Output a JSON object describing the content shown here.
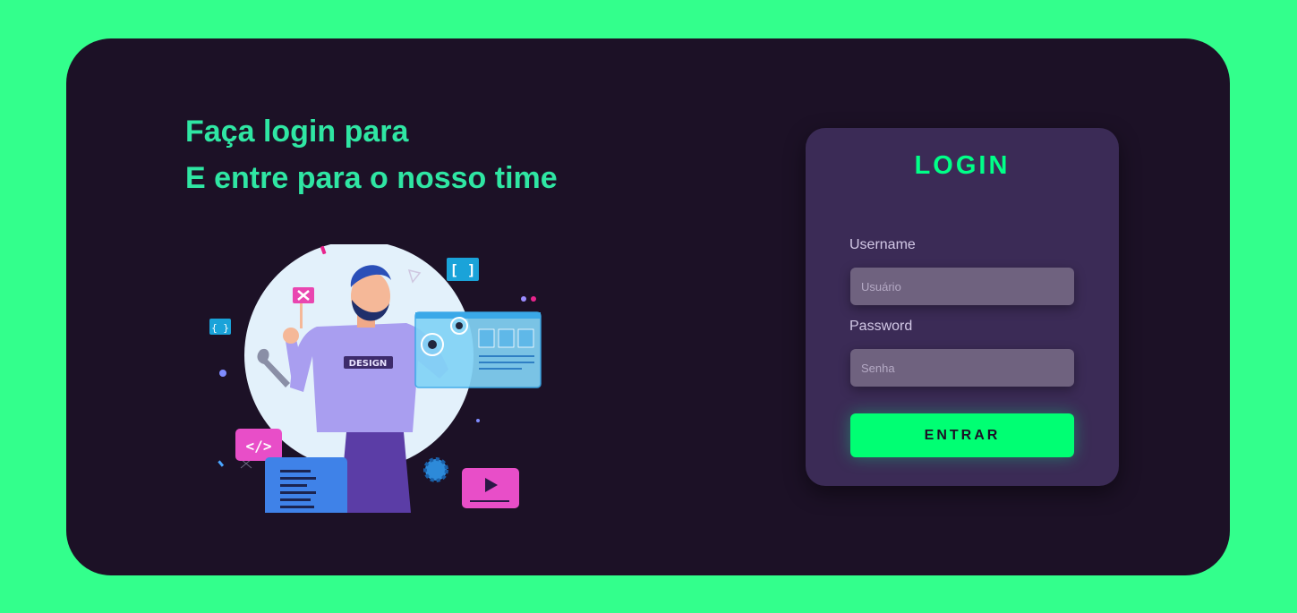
{
  "headline": {
    "line1": "Faça login para",
    "line2": "E entre para o nosso time"
  },
  "illustration": {
    "badge_text": "DESIGN",
    "code_icon_text": "</>",
    "bracket_icon_text": "[ ]",
    "small_bracket_text": "{ }"
  },
  "login": {
    "title": "LOGIN",
    "username_label": "Username",
    "username_placeholder": "Usuário",
    "password_label": "Password",
    "password_placeholder": "Senha",
    "submit_label": "ENTRAR"
  },
  "colors": {
    "page_background": "#33ff8c",
    "panel_background": "#1c1126",
    "card_background": "#3b2b56",
    "accent": "#00ff88",
    "headline": "#2fe6a3"
  }
}
